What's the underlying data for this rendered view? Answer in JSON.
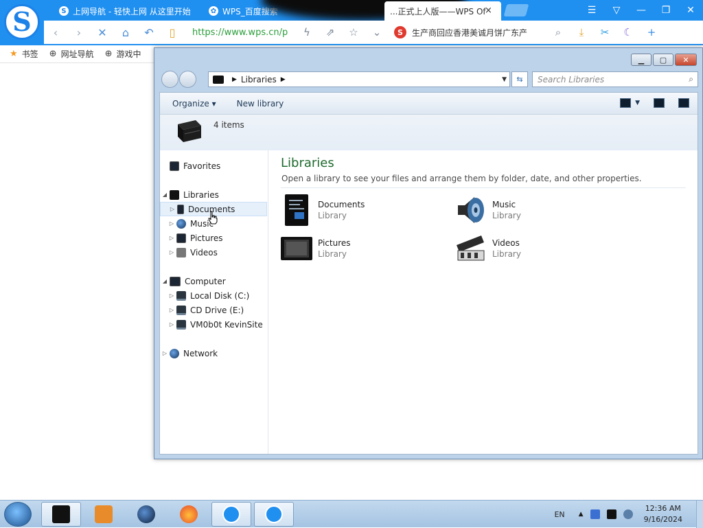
{
  "browser": {
    "logo_letter": "S",
    "tabs": [
      {
        "title": "上网导航 - 轻快上网 从这里开始",
        "icon": "S"
      },
      {
        "title": "WPS_百度搜索",
        "icon": "✿"
      },
      {
        "title": "...正式上人版——WPS Of",
        "icon": ""
      }
    ],
    "tab_close": "×",
    "url": "https://www.wps.cn/p",
    "news_ticker": "生产商回应香港美诚月饼广东产",
    "search_engine_letter": "S",
    "bookmarks": [
      {
        "label": "书签",
        "icon": "★"
      },
      {
        "label": "网址导航",
        "icon": "⊕"
      },
      {
        "label": "游戏中",
        "icon": "⊕"
      }
    ]
  },
  "explorer": {
    "breadcrumb": "Libraries",
    "search_placeholder": "Search Libraries",
    "toolbar": {
      "organize": "Organize ▾",
      "new_library": "New library"
    },
    "details": {
      "count": "4 items"
    },
    "nav": {
      "favorites": "Favorites",
      "libraries": "Libraries",
      "library_children": [
        "Documents",
        "Music",
        "Pictures",
        "Videos"
      ],
      "computer": "Computer",
      "computer_children": [
        "Local Disk (C:)",
        "CD Drive (E:)",
        "VM0b0t KevinSite"
      ],
      "network": "Network"
    },
    "content": {
      "title": "Libraries",
      "description": "Open a library to see your files and arrange them by folder, date, and other properties.",
      "tiles": [
        {
          "name": "Documents",
          "type": "Library"
        },
        {
          "name": "Music",
          "type": "Library"
        },
        {
          "name": "Pictures",
          "type": "Library"
        },
        {
          "name": "Videos",
          "type": "Library"
        }
      ]
    }
  },
  "taskbar": {
    "language": "EN",
    "time": "12:36 AM",
    "date": "9/16/2024"
  }
}
